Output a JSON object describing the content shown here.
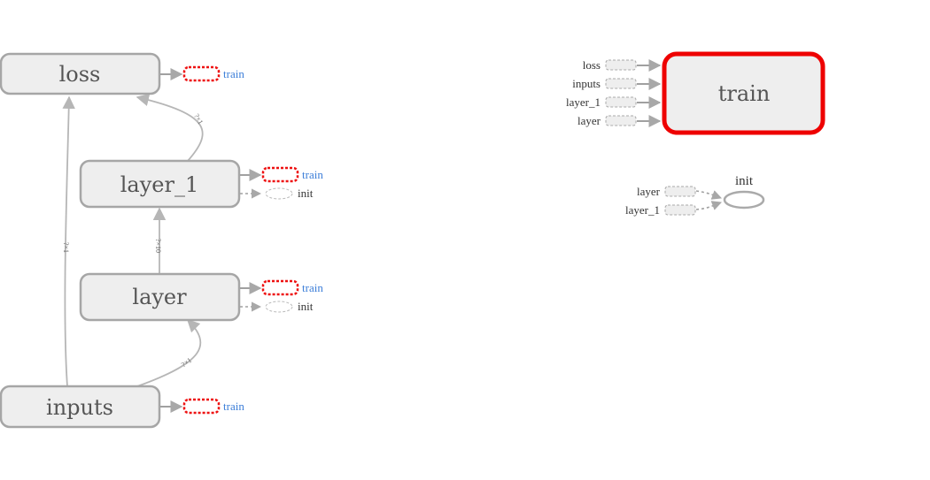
{
  "main_graph": {
    "nodes": {
      "loss": "loss",
      "layer_1": "layer_1",
      "layer": "layer",
      "inputs": "inputs"
    },
    "edge_labels": {
      "layer_1_to_loss": "?×1",
      "layer_to_layer_1": "?×10",
      "inputs_to_layer": "?×1",
      "inputs_to_loss": "?×1"
    },
    "aux_labels": {
      "train": "train",
      "init": "init"
    }
  },
  "train_group": {
    "title": "train",
    "inputs": [
      "loss",
      "inputs",
      "layer_1",
      "layer"
    ]
  },
  "init_group": {
    "title": "init",
    "inputs": [
      "layer",
      "layer_1"
    ]
  },
  "colors": {
    "node_fill": "#eeeeee",
    "node_stroke": "#a6a6a6",
    "selected_stroke": "#ee0000",
    "train_link": "#3b7dd8",
    "stub_red": "#ee1111"
  }
}
